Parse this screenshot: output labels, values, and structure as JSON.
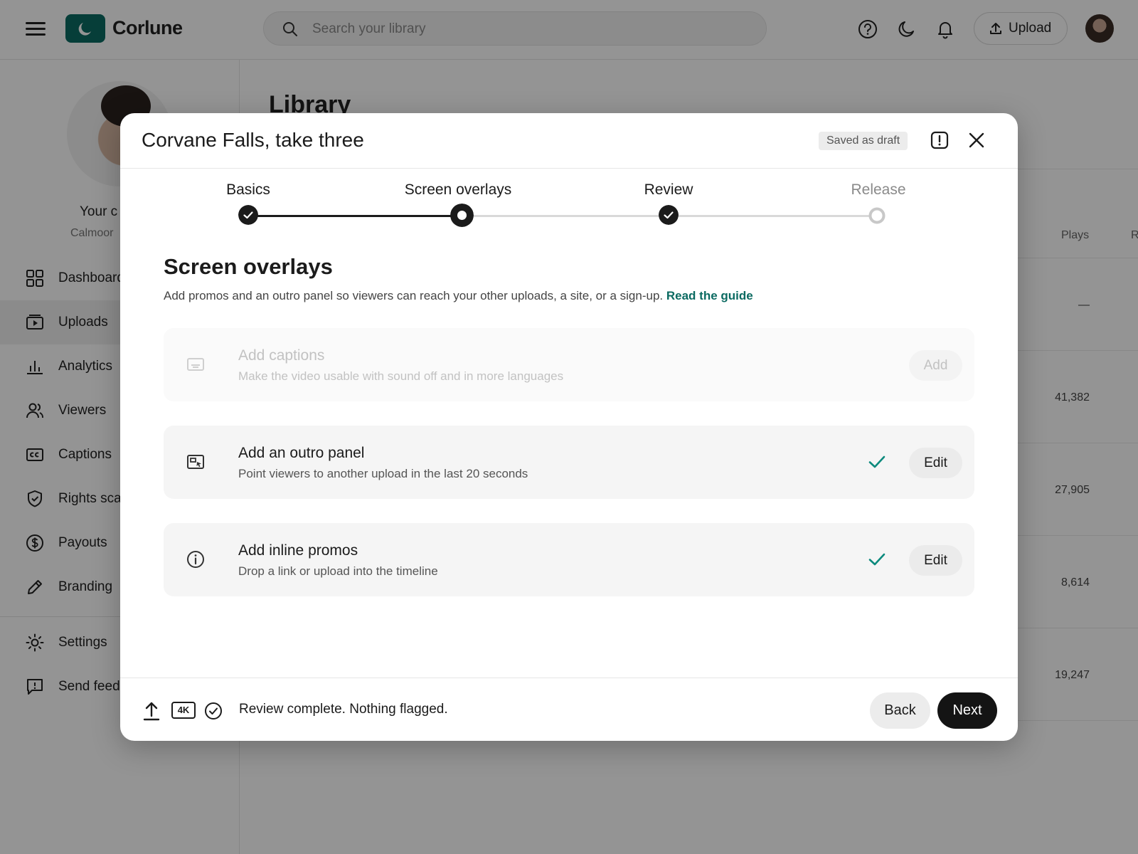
{
  "app": {
    "name": "Corlune",
    "search_placeholder": "Search your library",
    "upload_label": "Upload",
    "icons": [
      "menu-icon",
      "logo-moon-icon",
      "search-icon",
      "help-icon",
      "dark-mode-icon",
      "bell-icon",
      "upload-icon",
      "avatar"
    ]
  },
  "sidebar": {
    "channel_name": "Your c",
    "channel_handle": "Calmoor",
    "items": [
      {
        "label": "Dashboard",
        "icon": "grid-icon"
      },
      {
        "label": "Uploads",
        "icon": "video-icon",
        "active": true
      },
      {
        "label": "Analytics",
        "icon": "chart-icon"
      },
      {
        "label": "Viewers",
        "icon": "users-icon"
      },
      {
        "label": "Captions",
        "icon": "cc-icon"
      },
      {
        "label": "Rights sca",
        "icon": "shield-icon"
      },
      {
        "label": "Payouts",
        "icon": "dollar-icon"
      },
      {
        "label": "Branding",
        "icon": "pencil-icon"
      },
      {
        "label": "Settings",
        "icon": "gear-icon"
      },
      {
        "label": "Send feed",
        "icon": "feedback-icon"
      }
    ]
  },
  "main": {
    "title": "Library",
    "columns": [
      "Plays",
      "R"
    ],
    "plays": [
      "—",
      "41,382",
      "27,905",
      "8,614",
      "19,247"
    ]
  },
  "modal": {
    "title": "Corvane Falls, take three",
    "draft_badge": "Saved as draft",
    "steps": [
      {
        "label": "Basics",
        "state": "complete"
      },
      {
        "label": "Screen overlays",
        "state": "current"
      },
      {
        "label": "Review",
        "state": "complete"
      },
      {
        "label": "Release",
        "state": "pending"
      }
    ],
    "section_title": "Screen overlays",
    "section_desc": "Add promos and an outro panel so viewers can reach your other uploads, a site, or a sign-up.",
    "guide_link": "Read the guide",
    "cards": [
      {
        "title": "Add captions",
        "subtitle": "Make the video usable with sound off and in more languages",
        "button": "Add",
        "enabled": false,
        "done": false,
        "icon": "captions-icon"
      },
      {
        "title": "Add an outro panel",
        "subtitle": "Point viewers to another upload in the last 20 seconds",
        "button": "Edit",
        "enabled": true,
        "done": true,
        "icon": "outro-panel-icon"
      },
      {
        "title": "Add inline promos",
        "subtitle": "Drop a link or upload into the timeline",
        "button": "Edit",
        "enabled": true,
        "done": true,
        "icon": "info-icon"
      }
    ],
    "footer": {
      "quality_badge": "4K",
      "status": "Review complete. Nothing flagged.",
      "back": "Back",
      "next": "Next"
    }
  },
  "colors": {
    "accent": "#0c6b62",
    "primary_button": "#141414",
    "check": "#0c8a7d"
  }
}
